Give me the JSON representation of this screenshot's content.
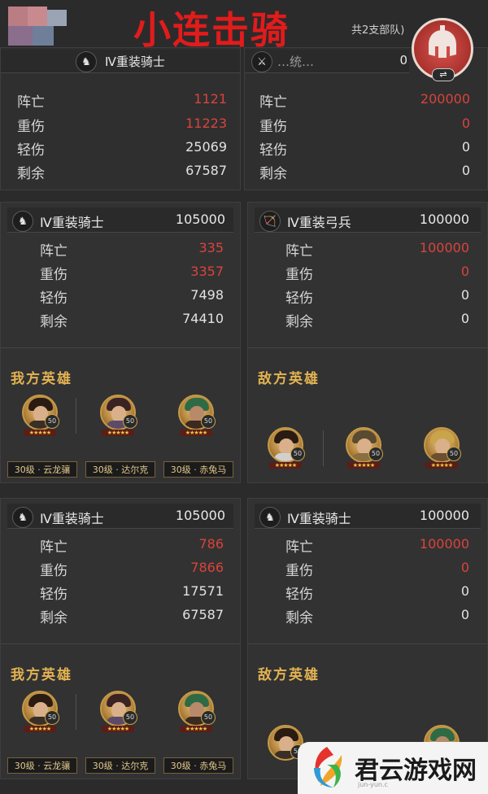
{
  "overlay_title": "小连击骑",
  "top": {
    "header_note": "共2支部队)",
    "left_unit": "Ⅳ重装骑士",
    "right_unit": "…统…",
    "right_count": "0",
    "left_rows": [
      {
        "label": "阵亡",
        "value": "1121"
      },
      {
        "label": "重伤",
        "value": "11223"
      },
      {
        "label": "轻伤",
        "value": "25069"
      },
      {
        "label": "剩余",
        "value": "67587"
      }
    ],
    "right_rows": [
      {
        "label": "阵亡",
        "value": "200000"
      },
      {
        "label": "重伤",
        "value": "0"
      },
      {
        "label": "轻伤",
        "value": "0"
      },
      {
        "label": "剩余",
        "value": "0"
      }
    ]
  },
  "battle1": {
    "left": {
      "unit": "Ⅳ重装骑士",
      "count": "105000",
      "rows": [
        {
          "label": "阵亡",
          "value": "335"
        },
        {
          "label": "重伤",
          "value": "3357"
        },
        {
          "label": "轻伤",
          "value": "7498"
        },
        {
          "label": "剩余",
          "value": "74410"
        }
      ],
      "heroes_title": "我方英雄",
      "heroes": [
        {
          "level": "50"
        },
        {
          "level": "50"
        },
        {
          "level": "50"
        }
      ],
      "tags": [
        "30级 · 云龙骧",
        "30级 · 达尔克",
        "30级 · 赤兔马"
      ]
    },
    "right": {
      "unit": "Ⅳ重装弓兵",
      "count": "100000",
      "rows": [
        {
          "label": "阵亡",
          "value": "100000"
        },
        {
          "label": "重伤",
          "value": "0"
        },
        {
          "label": "轻伤",
          "value": "0"
        },
        {
          "label": "剩余",
          "value": "0"
        }
      ],
      "heroes_title": "敌方英雄",
      "heroes": [
        {
          "level": "50"
        },
        {
          "level": "50"
        },
        {
          "level": "50"
        }
      ]
    }
  },
  "battle2": {
    "left": {
      "unit": "Ⅳ重装骑士",
      "count": "105000",
      "rows": [
        {
          "label": "阵亡",
          "value": "786"
        },
        {
          "label": "重伤",
          "value": "7866"
        },
        {
          "label": "轻伤",
          "value": "17571"
        },
        {
          "label": "剩余",
          "value": "67587"
        }
      ],
      "heroes_title": "我方英雄",
      "heroes": [
        {
          "level": "50"
        },
        {
          "level": "50"
        },
        {
          "level": "50"
        }
      ],
      "tags": [
        "30级 · 云龙骧",
        "30级 · 达尔克",
        "30级 · 赤兔马"
      ]
    },
    "right": {
      "unit": "Ⅳ重装骑士",
      "count": "100000",
      "rows": [
        {
          "label": "阵亡",
          "value": "100000"
        },
        {
          "label": "重伤",
          "value": "0"
        },
        {
          "label": "轻伤",
          "value": "0"
        },
        {
          "label": "剩余",
          "value": "0"
        }
      ],
      "heroes_title": "敌方英雄",
      "heroes": [
        {
          "level": "50"
        },
        {
          "level": "50"
        }
      ]
    }
  },
  "watermark": {
    "text": "君云游戏网",
    "sub": "jun-yun.c"
  },
  "colors": {
    "loss": "#d9443a",
    "gold": "#e3b352",
    "overlay": "#e21b1b"
  }
}
